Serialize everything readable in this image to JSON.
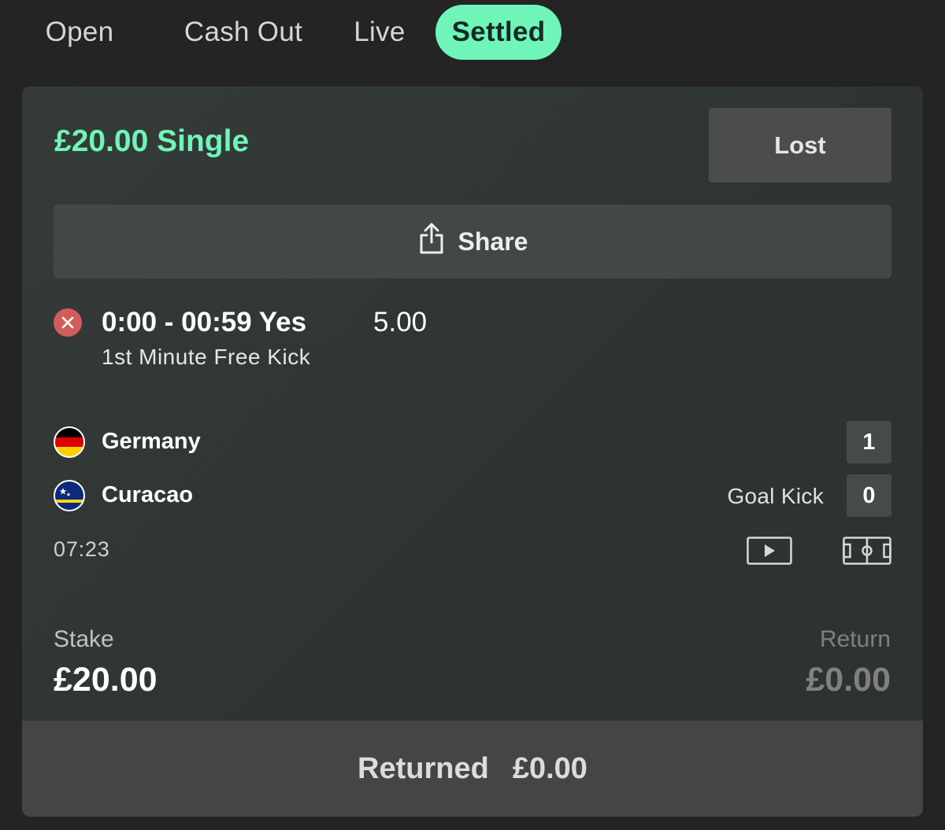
{
  "tabs": [
    {
      "label": "Open",
      "active": false
    },
    {
      "label": "Cash Out",
      "active": false
    },
    {
      "label": "Live",
      "active": false
    },
    {
      "label": "Settled",
      "active": true
    }
  ],
  "bet": {
    "title": "£20.00 Single",
    "status": "Lost",
    "share_label": "Share",
    "selection": {
      "name": "0:00 - 00:59 Yes",
      "odds": "5.00",
      "market": "1st Minute Free Kick",
      "result_icon": "cross-icon"
    },
    "event": {
      "home": {
        "name": "Germany",
        "score": "1",
        "flag": "germany-flag"
      },
      "away": {
        "name": "Curacao",
        "score": "0",
        "flag": "curacao-flag"
      },
      "live_status": "Goal Kick",
      "clock": "07:23"
    },
    "stake": {
      "label": "Stake",
      "value": "£20.00"
    },
    "return": {
      "label": "Return",
      "value": "£0.00"
    },
    "returned": {
      "label": "Returned",
      "value": "£0.00"
    }
  },
  "colors": {
    "accent": "#6ff5b8",
    "background": "#242424",
    "card": "#323736",
    "lost_red": "#d25c5c"
  }
}
